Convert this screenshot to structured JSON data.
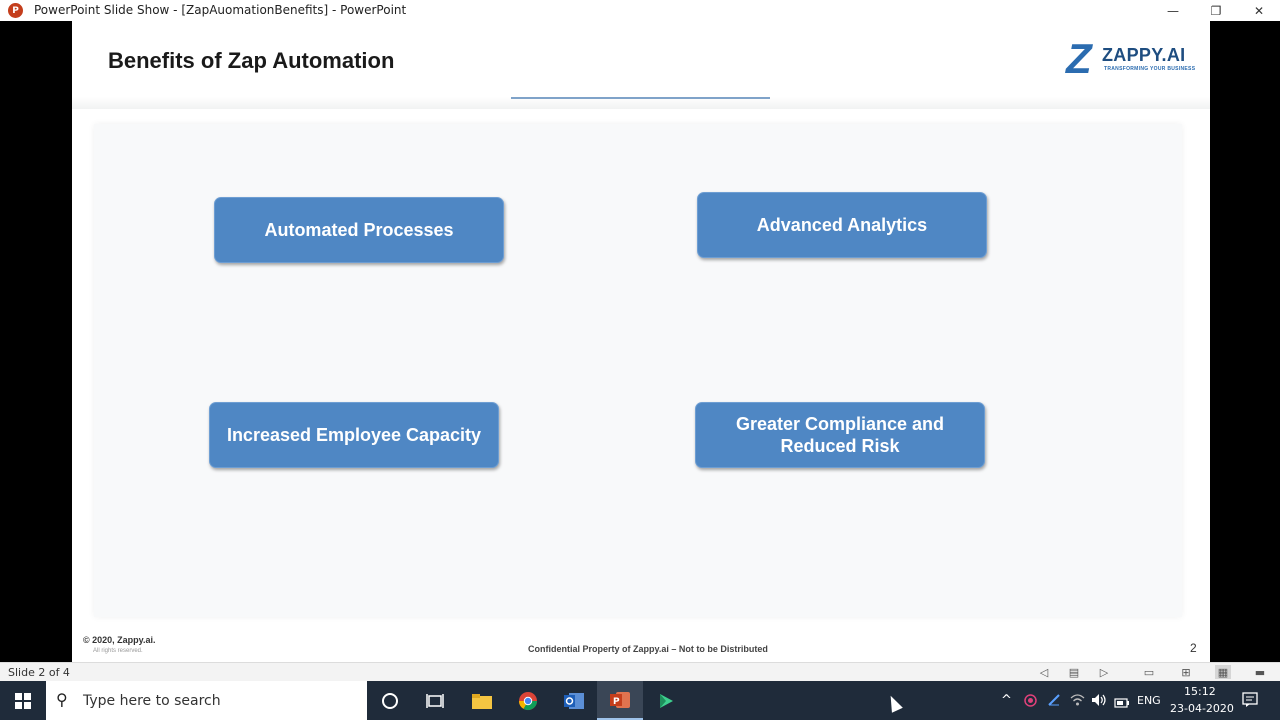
{
  "window": {
    "title": "PowerPoint Slide Show - [ZapAuomationBenefits] - PowerPoint",
    "app_icon_letter": "P",
    "minimize": "—",
    "restore": "❐",
    "close": "✕"
  },
  "slide": {
    "title": "Benefits of Zap Automation",
    "logo": {
      "mark": "Z",
      "name": "ZAPPY.AI",
      "tagline": "TRANSFORMING YOUR BUSINESS"
    },
    "benefits": [
      "Automated Processes",
      "Advanced Analytics",
      "Increased Employee Capacity",
      "Greater Compliance and Reduced Risk"
    ],
    "copyright": "© 2020, Zappy.ai.",
    "rights": "All rights reserved.",
    "confidential": "Confidential Property of Zappy.ai – Not to be Distributed",
    "number": "2"
  },
  "statusbar": {
    "slide_count": "Slide 2 of 4",
    "icons": [
      "◁",
      "▤",
      "▷",
      "▭",
      "⊞",
      "▦",
      "▬"
    ]
  },
  "taskbar": {
    "search_placeholder": "Type here to search",
    "search_icon": "⚲",
    "apps": [
      "cortana-icon",
      "task-view-icon",
      "file-explorer-icon",
      "chrome-icon",
      "outlook-icon",
      "powerpoint-icon",
      "camtasia-icon"
    ],
    "tray": {
      "chevron": "^",
      "language": "ENG",
      "time": "15:12",
      "date": "23-04-2020"
    }
  },
  "colors": {
    "accent": "#4f87c4",
    "taskbar": "#1f2b3a",
    "powerpoint": "#c43e1c"
  }
}
